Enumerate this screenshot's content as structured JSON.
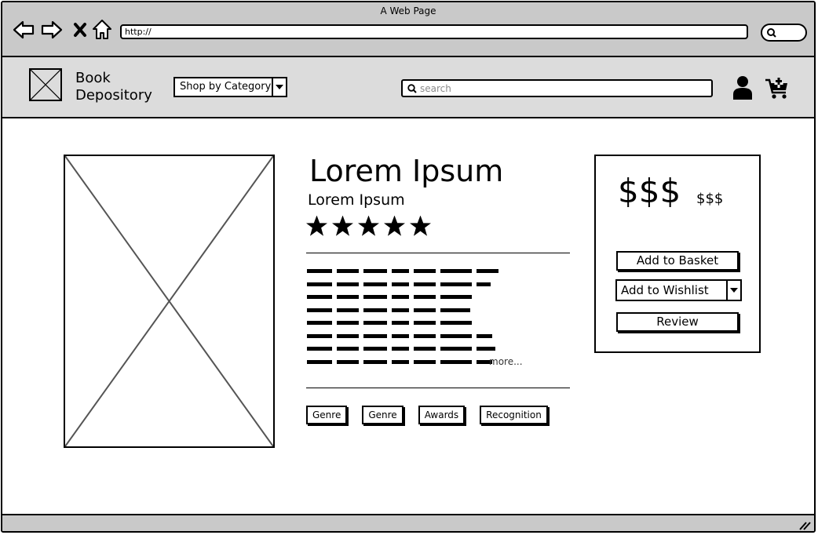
{
  "window": {
    "title": "A Web Page"
  },
  "browser": {
    "back_icon": "back-arrow-icon",
    "forward_icon": "forward-arrow-icon",
    "stop_icon": "close-x-icon",
    "home_icon": "home-icon",
    "url": "http://"
  },
  "header": {
    "logo_icon": "image-placeholder-icon",
    "logo_line1": "Book",
    "logo_line2": "Depository",
    "category_label": "Shop by Category",
    "search_placeholder": "search",
    "user_icon": "user-icon",
    "cart_icon": "cart-add-icon"
  },
  "product": {
    "image_icon": "image-placeholder-icon",
    "title": "Lorem Ipsum",
    "subtitle": "Lorem Ipsum",
    "rating": 5,
    "rating_max": 5,
    "more_label": "more...",
    "tags": [
      "Genre",
      "Genre",
      "Awards",
      "Recognition"
    ]
  },
  "purchase": {
    "price": "$$$",
    "price_small": "$$$",
    "add_to_basket": "Add to Basket",
    "add_to_wishlist": "Add to Wishlist",
    "review": "Review"
  },
  "colors": {
    "chrome": "#c9c9c9",
    "header": "#dcdcdc",
    "stroke": "#000000"
  }
}
